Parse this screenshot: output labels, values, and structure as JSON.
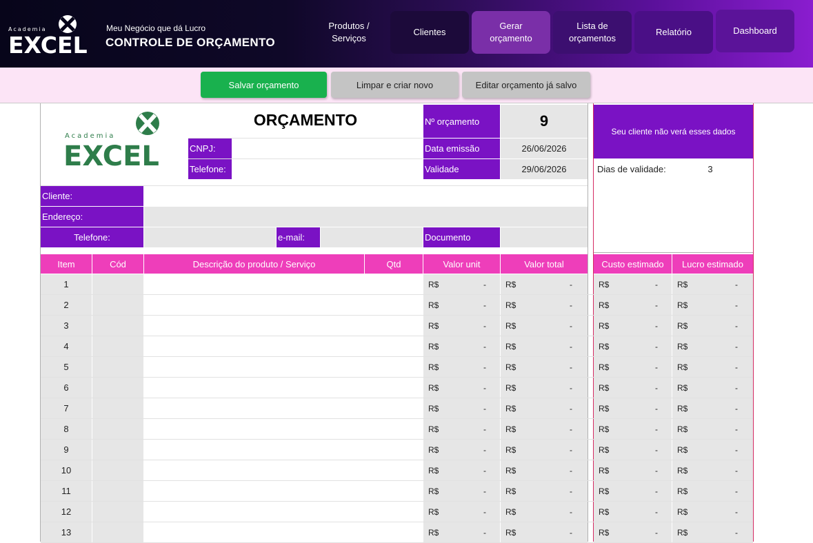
{
  "header": {
    "logo": {
      "small": "Academia",
      "main": "EXCEL"
    },
    "subtitle": "Meu Negócio que dá Lucro",
    "title": "CONTROLE DE ORÇAMENTO",
    "nav": [
      {
        "label_line1": "Produtos /",
        "label_line2": "Serviços"
      },
      {
        "label_line1": "Clientes",
        "label_line2": ""
      },
      {
        "label_line1": "Gerar",
        "label_line2": "orçamento"
      },
      {
        "label_line1": "Lista de",
        "label_line2": "orçamentos"
      },
      {
        "label_line1": "Relatório",
        "label_line2": ""
      },
      {
        "label_line1": "Dashboard",
        "label_line2": ""
      }
    ],
    "active_color": "#7a2fa8"
  },
  "toolbar": {
    "save_label": "Salvar orçamento",
    "clear_label": "Limpar e criar novo",
    "edit_label": "Editar orçamento já salvo",
    "save_color": "#19b14e"
  },
  "sheet": {
    "logo": {
      "small": "Academia",
      "main": "EXCEL",
      "color": "#2e7d4a"
    },
    "title": "ORÇAMENTO",
    "cnpj_label": "CNPJ:",
    "phone_label": "Telefone:",
    "num_label": "Nº orçamento",
    "num_value": "9",
    "emission_label": "Data emissão",
    "emission_value": "26/06/2026",
    "validity_label": "Validade",
    "validity_value": "29/06/2026",
    "client_label": "Cliente:",
    "address_label": "Endereço:",
    "client_phone_label": "Telefone:",
    "email_label": "e-mail:",
    "document_label": "Documento",
    "private_note": "Seu cliente não verá esses dados",
    "validity_days_label": "Dias de validade:",
    "validity_days_value": "3",
    "columns": {
      "item": "Item",
      "cod": "Cód",
      "desc": "Descrição do produto / Serviço",
      "qty": "Qtd",
      "unit": "Valor unit",
      "total": "Valor total",
      "cost": "Custo estimado",
      "profit": "Lucro estimado"
    },
    "currency": "R$",
    "empty_value": "-",
    "rows": [
      "1",
      "2",
      "3",
      "4",
      "5",
      "6",
      "7",
      "8",
      "9",
      "10",
      "11",
      "12",
      "13"
    ],
    "purple_color": "#7a12c4",
    "pink_color": "#ee3eba"
  }
}
